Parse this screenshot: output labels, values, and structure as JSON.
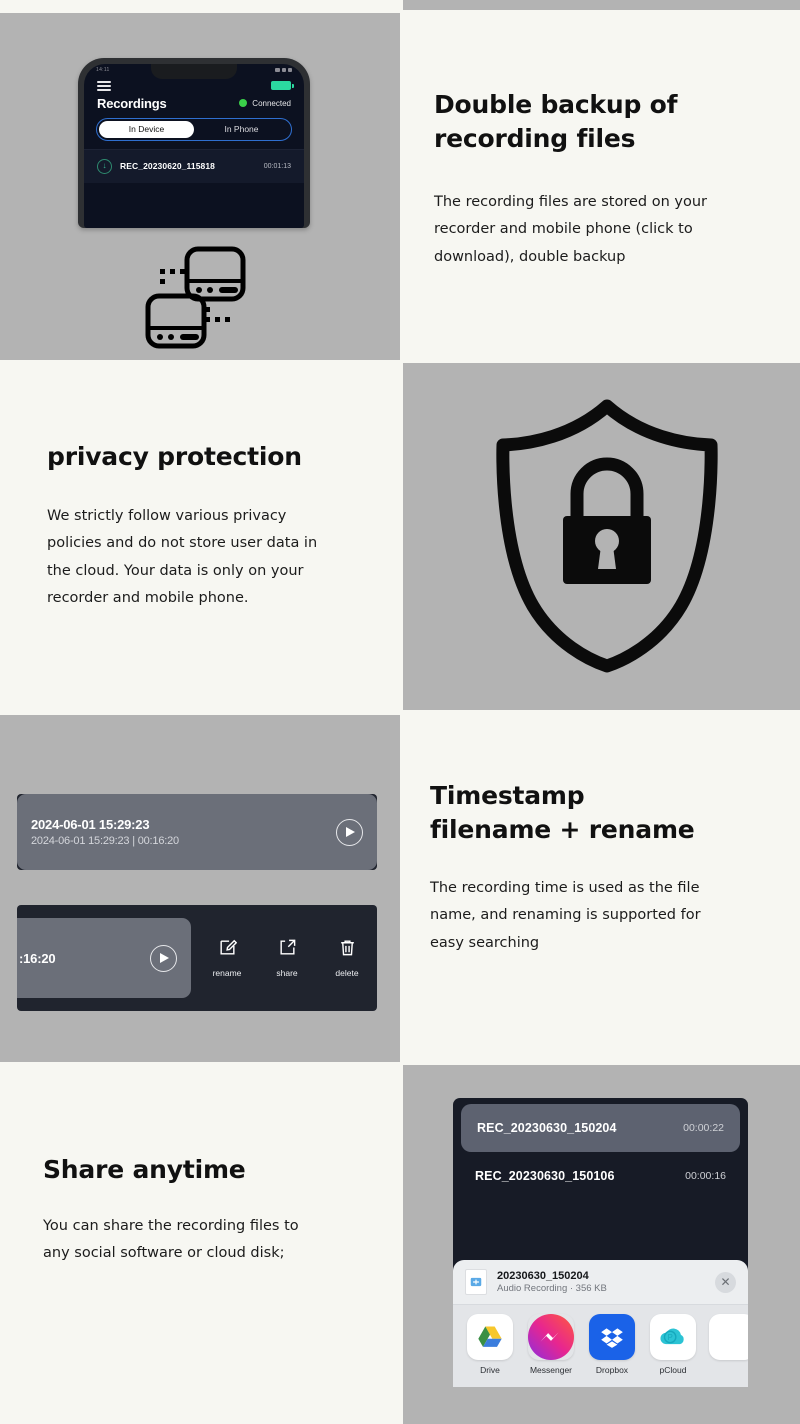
{
  "theme": {
    "cream": "#f7f7f2",
    "gray": "#b3b3b3",
    "accent_green": "#2bd9a0",
    "connected_green": "#3bd14a",
    "segment_blue": "#2f6fd0"
  },
  "features": [
    {
      "headline_line1": "Double backup of",
      "headline_line2": "recording files",
      "body": "The recording files are stored on your recorder and mobile phone (click to download), double backup"
    },
    {
      "headline_line1": "privacy protection",
      "headline_line2": "",
      "body": "We strictly follow various privacy policies and do not store user data in the cloud. Your data is only on your recorder and mobile phone."
    },
    {
      "headline_line1": "Timestamp",
      "headline_line2": "filename + rename",
      "body": "The recording time is used as the file name, and renaming is supported for easy searching"
    },
    {
      "headline_line1": "Share anytime",
      "headline_line2": "",
      "body": "You can share the recording files to any social software or cloud disk;"
    }
  ],
  "phone_app": {
    "status_time": "14:11",
    "menu_icon": "hamburger-icon",
    "battery_icon": "battery-icon",
    "screen_title": "Recordings",
    "connection_status": "Connected",
    "tabs": [
      {
        "label": "In Device",
        "active": true
      },
      {
        "label": "In Phone",
        "active": false
      }
    ],
    "recordings": [
      {
        "download_icon": "download-icon",
        "name": "REC_20230620_115818",
        "duration": "00:01:13"
      }
    ]
  },
  "devices_icon": "two-recorder-devices-icon",
  "shield_icon": "shield-lock-icon",
  "recording_cards": {
    "card_one": {
      "title": "2024-06-01 15:29:23",
      "subtitle": "2024-06-01 15:29:23 | 00:16:20",
      "play_icon": "play-icon"
    },
    "card_two": {
      "partial_duration": ":16:20",
      "play_icon": "play-icon",
      "actions": [
        {
          "icon": "rename-pencil-icon",
          "label": "rename"
        },
        {
          "icon": "share-arrow-icon",
          "label": "share"
        },
        {
          "icon": "trash-delete-icon",
          "label": "delete"
        }
      ]
    }
  },
  "share_sheet": {
    "recordings": [
      {
        "name": "REC_20230630_150204",
        "duration": "00:00:22",
        "selected": true
      },
      {
        "name": "REC_20230630_150106",
        "duration": "00:00:16",
        "selected": false
      }
    ],
    "file": {
      "icon": "audio-file-icon",
      "name": "20230630_150204",
      "meta": "Audio Recording · 356 KB",
      "close_icon": "close-icon"
    },
    "apps": [
      {
        "icon": "google-drive-icon",
        "label": "Drive"
      },
      {
        "icon": "messenger-icon",
        "label": "Messenger"
      },
      {
        "icon": "dropbox-icon",
        "label": "Dropbox"
      },
      {
        "icon": "pcloud-icon",
        "label": "pCloud"
      }
    ]
  }
}
